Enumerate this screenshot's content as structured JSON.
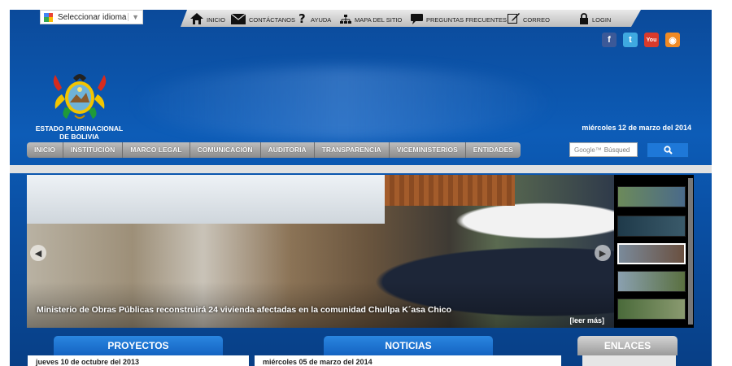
{
  "language": {
    "label": "Seleccionar idioma"
  },
  "topnav": {
    "items": [
      {
        "label": "INICIO",
        "icon": "home-icon"
      },
      {
        "label": "CONTÁCTANOS",
        "icon": "mail-icon"
      },
      {
        "label": "AYUDA",
        "icon": "help-icon"
      },
      {
        "label": "MAPA DEL SITIO",
        "icon": "sitemap-icon"
      },
      {
        "label": "PREGUNTAS FRECUENTES",
        "icon": "chat-icon"
      },
      {
        "label": "CORREO",
        "icon": "edit-icon"
      },
      {
        "label": "LOGIN",
        "icon": "lock-icon"
      }
    ]
  },
  "social": [
    "facebook-icon",
    "twitter-icon",
    "youtube-icon",
    "rss-icon"
  ],
  "logo": {
    "line1": "ESTADO PLURINACIONAL",
    "line2": "DE BOLIVIA"
  },
  "date": "miércoles 12 de marzo del 2014",
  "mainnav": [
    "INICIO",
    "INSTITUCIÓN",
    "MARCO LEGAL",
    "COMUNICACIÓN",
    "AUDITORIA",
    "TRANSPARENCIA",
    "VICEMINISTERIOS",
    "ENTIDADES"
  ],
  "search": {
    "brand": "Google™",
    "placeholder": "Búsqued"
  },
  "slider": {
    "caption": "Ministerio de Obras Públicas reconstruirá 24 vivienda afectadas en la comunidad Chullpa K´asa Chico",
    "readmore": "[leer más]"
  },
  "sections": {
    "proyectos": {
      "title": "PROYECTOS",
      "date": "jueves 10 de octubre del 2013"
    },
    "noticias": {
      "title": "NOTICIAS",
      "date": "miércoles 05 de marzo del 2014"
    },
    "enlaces": {
      "title": "ENLACES"
    }
  },
  "colors": {
    "brand_blue": "#0d5cb7",
    "accent_button": "#1e78d8",
    "section_header": "#1b6fd0",
    "enlaces_header": "#a9a9a9"
  }
}
